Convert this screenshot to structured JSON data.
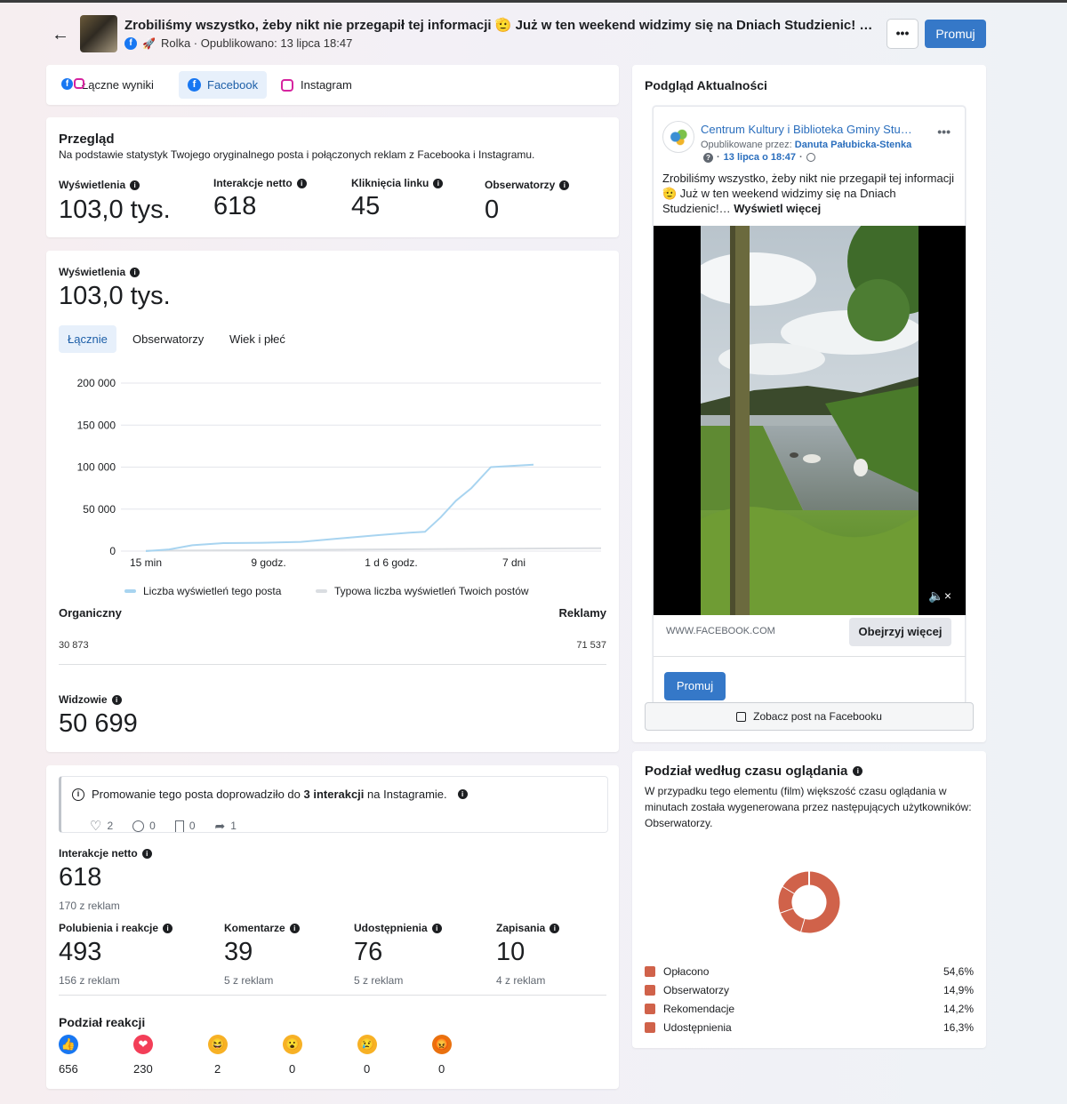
{
  "header": {
    "title": "Zrobiliśmy wszystko, żeby nikt nie przegapił tej informacji 🫡 Już w ten weekend widzimy się na Dniach Studzienic! Wójt Bogdan Kaszubowski…",
    "subtitle": "Rolka · Opublikowano: 13 lipca 18:47",
    "more_label": "•••",
    "promote_label": "Promuj"
  },
  "tabs": [
    {
      "label": "Łączne wyniki"
    },
    {
      "label": "Facebook"
    },
    {
      "label": "Instagram"
    }
  ],
  "overview": {
    "title": "Przegląd",
    "desc": "Na podstawie statystyk Twojego oryginalnego posta i połączonych reklam z Facebooka i Instagramu.",
    "metrics": [
      {
        "label": "Wyświetlenia",
        "value": "103,0 tys."
      },
      {
        "label": "Interakcje netto",
        "value": "618"
      },
      {
        "label": "Kliknięcia linku",
        "value": "45"
      },
      {
        "label": "Obserwatorzy",
        "value": "0"
      }
    ]
  },
  "views": {
    "label": "Wyświetlenia",
    "value": "103,0 tys.",
    "subtabs": [
      {
        "label": "Łącznie"
      },
      {
        "label": "Obserwatorzy"
      },
      {
        "label": "Wiek i płeć"
      }
    ],
    "organic_label": "Organiczny",
    "organic_value": "30 873",
    "ads_label": "Reklamy",
    "ads_value": "71 537",
    "viewers_label": "Widzowie",
    "viewers_value": "50 699"
  },
  "chart_data": {
    "type": "line",
    "x_ticks": [
      "15 min",
      "9 godz.",
      "1 d 6 godz.",
      "7 dni"
    ],
    "y_ticks": [
      "200 000",
      "150 000",
      "100 000",
      "50 000",
      "0"
    ],
    "ylim": [
      0,
      200000
    ],
    "grid": true,
    "legend_position": "bottom",
    "series": [
      {
        "name": "Liczba wyświetleń tego posta",
        "color": "#a8d4f0",
        "points": [
          [
            0,
            0
          ],
          [
            0.06,
            2000
          ],
          [
            0.12,
            7000
          ],
          [
            0.2,
            9500
          ],
          [
            0.3,
            10000
          ],
          [
            0.4,
            11000
          ],
          [
            0.5,
            15000
          ],
          [
            0.6,
            19000
          ],
          [
            0.68,
            22000
          ],
          [
            0.72,
            23000
          ],
          [
            0.76,
            40000
          ],
          [
            0.8,
            60000
          ],
          [
            0.84,
            75000
          ],
          [
            0.89,
            100000
          ],
          [
            1.0,
            103000
          ]
        ]
      },
      {
        "name": "Typowa liczba wyświetleń Twoich postów",
        "color": "#dadde1",
        "points": [
          [
            0,
            500
          ],
          [
            0.2,
            1000
          ],
          [
            0.5,
            2000
          ],
          [
            0.8,
            3000
          ],
          [
            1.0,
            3500
          ]
        ]
      }
    ]
  },
  "interactions": {
    "ig_note_pre": "Promowanie tego posta doprowadziło do ",
    "ig_note_bold": "3 interakcji",
    "ig_note_post": " na Instagramie.",
    "ig_reactions": [
      {
        "icon": "heart-outline-icon",
        "value": "2"
      },
      {
        "icon": "comment-icon",
        "value": "0"
      },
      {
        "icon": "bookmark-icon",
        "value": "0"
      },
      {
        "icon": "share-icon",
        "value": "1"
      }
    ],
    "net_label": "Interakcje netto",
    "net_value": "618",
    "net_sub": "170 z reklam",
    "metrics": [
      {
        "label": "Polubienia i reakcje",
        "value": "493",
        "sub": "156 z reklam"
      },
      {
        "label": "Komentarze",
        "value": "39",
        "sub": "5 z reklam"
      },
      {
        "label": "Udostępnienia",
        "value": "76",
        "sub": "5 z reklam"
      },
      {
        "label": "Zapisania",
        "value": "10",
        "sub": "4 z reklam"
      }
    ],
    "breakdown_title": "Podział reakcji",
    "reactions": [
      {
        "icon": "like-icon",
        "value": "656"
      },
      {
        "icon": "love-icon",
        "value": "230"
      },
      {
        "icon": "haha-icon",
        "value": "2"
      },
      {
        "icon": "wow-icon",
        "value": "0"
      },
      {
        "icon": "sad-icon",
        "value": "0"
      },
      {
        "icon": "angry-icon",
        "value": "0"
      }
    ]
  },
  "preview": {
    "title": "Podgląd Aktualności",
    "page_name": "Centrum Kultury i Biblioteka Gminy Stu…",
    "published_by_label": "Opublikowane przez:",
    "published_by": "Danuta Pałubicka-Stenka",
    "date": "13 lipca o 18:47",
    "text": "Zrobiliśmy wszystko, żeby nikt nie przegapił tej informacji 🫡 Już w ten weekend widzimy się na Dniach Studzienic!…",
    "see_more": "Wyświetl więcej",
    "link_domain": "WWW.FACEBOOK.COM",
    "cta_label": "Obejrzyj więcej",
    "promote_label": "Promuj",
    "view_post_label": "Zobacz post na Facebooku",
    "menu_label": "•••"
  },
  "watch_time": {
    "title": "Podział według czasu oglądania",
    "desc": "W przypadku tego elementu (film) większość czasu oglądania w minutach została wygenerowana przez następujących użytkowników: Obserwatorzy.",
    "color": "#d0624a",
    "items": [
      {
        "label": "Opłacono",
        "value": "54,6%",
        "share": 54.6
      },
      {
        "label": "Obserwatorzy",
        "value": "14,9%",
        "share": 14.9
      },
      {
        "label": "Rekomendacje",
        "value": "14,2%",
        "share": 14.2
      },
      {
        "label": "Udostępnienia",
        "value": "16,3%",
        "share": 16.3
      }
    ]
  }
}
